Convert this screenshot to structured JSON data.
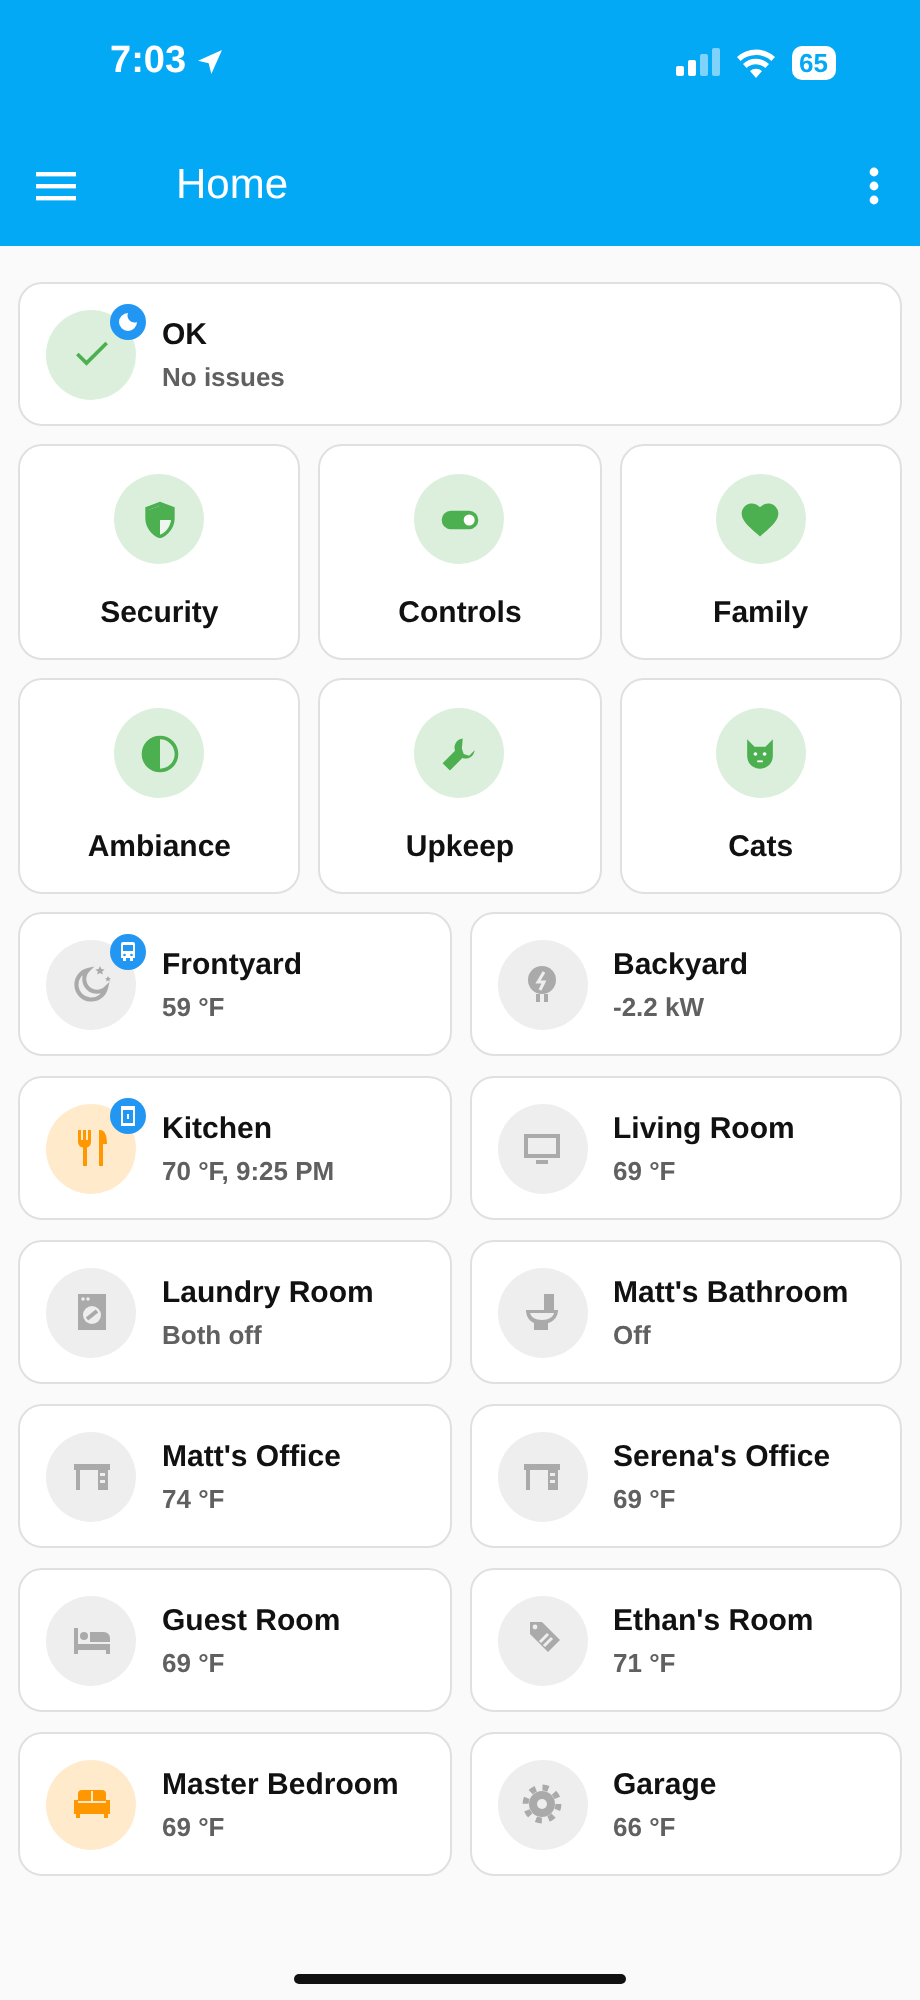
{
  "status_bar": {
    "time": "7:03",
    "battery": "65"
  },
  "app_bar": {
    "title": "Home"
  },
  "summary": {
    "title": "OK",
    "subtitle": "No issues",
    "badge": {
      "kind": "moon"
    }
  },
  "areas": [
    {
      "label": "Security",
      "kind": "shield"
    },
    {
      "label": "Controls",
      "kind": "toggle"
    },
    {
      "label": "Family",
      "kind": "heart"
    },
    {
      "label": "Ambiance",
      "kind": "contrast"
    },
    {
      "label": "Upkeep",
      "kind": "wrench"
    },
    {
      "label": "Cats",
      "kind": "cat"
    }
  ],
  "rooms": [
    {
      "name": "Frontyard",
      "state": "59 °F",
      "kind": "night",
      "active": false,
      "badge": {
        "kind": "bus"
      }
    },
    {
      "name": "Backyard",
      "state": "-2.2 kW",
      "kind": "power",
      "active": false
    },
    {
      "name": "Kitchen",
      "state": "70 °F, 9:25 PM",
      "kind": "dining",
      "active": true,
      "badge": {
        "kind": "appliance"
      }
    },
    {
      "name": "Living Room",
      "state": "69 °F",
      "kind": "tv",
      "active": false
    },
    {
      "name": "Laundry Room",
      "state": "Both off",
      "kind": "washer",
      "active": false
    },
    {
      "name": "Matt's Bathroom",
      "state": "Off",
      "kind": "toilet",
      "active": false
    },
    {
      "name": "Matt's Office",
      "state": "74 °F",
      "kind": "desk",
      "active": false
    },
    {
      "name": "Serena's Office",
      "state": "69 °F",
      "kind": "desk",
      "active": false
    },
    {
      "name": "Guest Room",
      "state": "69 °F",
      "kind": "bed",
      "active": false
    },
    {
      "name": "Ethan's Room",
      "state": "71 °F",
      "kind": "tag",
      "active": false
    },
    {
      "name": "Master Bedroom",
      "state": "69 °F",
      "kind": "sofa",
      "active": true
    },
    {
      "name": "Garage",
      "state": "66 °F",
      "kind": "gear",
      "active": false
    }
  ]
}
